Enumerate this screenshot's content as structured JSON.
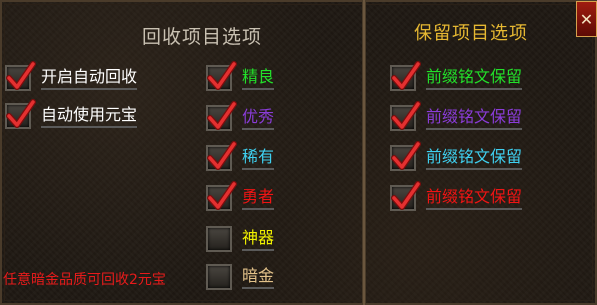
{
  "recycle": {
    "title": "回收项目选项",
    "options": [
      {
        "label": "开启自动回收",
        "checked": true,
        "color": "#ffffff"
      },
      {
        "label": "自动使用元宝",
        "checked": true,
        "color": "#ffffff"
      }
    ],
    "qualities": [
      {
        "label": "精良",
        "checked": true,
        "color": "#22e02a"
      },
      {
        "label": "优秀",
        "checked": true,
        "color": "#8a3cd9"
      },
      {
        "label": "稀有",
        "checked": true,
        "color": "#3fd0f0"
      },
      {
        "label": "勇者",
        "checked": true,
        "color": "#f01414"
      },
      {
        "label": "神器",
        "checked": false,
        "color": "#f0f000"
      },
      {
        "label": "暗金",
        "checked": false,
        "color": "#e3c28a"
      }
    ],
    "note": "任意暗金品质可回收2元宝",
    "note_color": "#e61b1b"
  },
  "keep": {
    "title": "保留项目选项",
    "title_color": "#e6b832",
    "items": [
      {
        "label": "前缀铭文保留",
        "checked": true,
        "color": "#22e02a"
      },
      {
        "label": "前缀铭文保留",
        "checked": true,
        "color": "#8a3cd9"
      },
      {
        "label": "前缀铭文保留",
        "checked": true,
        "color": "#3fd0f0"
      },
      {
        "label": "前缀铭文保留",
        "checked": true,
        "color": "#f01414"
      }
    ]
  },
  "close_icon": "close-icon",
  "close_glyph": "✕"
}
